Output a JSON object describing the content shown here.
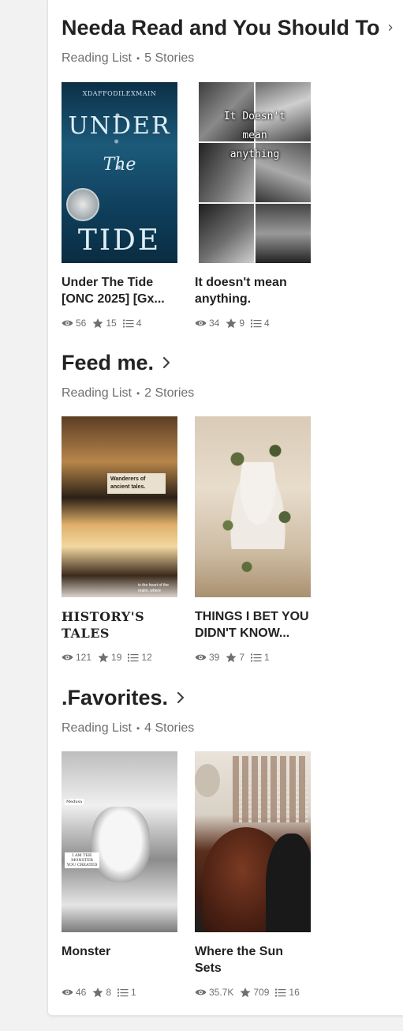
{
  "sections": [
    {
      "title": "Needa Read and You Should To",
      "subtitle_type": "Reading List",
      "subtitle_count": "5 Stories",
      "stories": [
        {
          "title": "Under The Tide [ONC 2025] [Gx...",
          "cover_author": "XDAFFODILEXMAIN",
          "cover_word1": "UNDER",
          "cover_word2": "The",
          "cover_word3": "TIDE",
          "reads": "56",
          "votes": "15",
          "parts": "4"
        },
        {
          "title": "It doesn't mean anything.",
          "cover_line1": "It Doesn't",
          "cover_line2": "mean",
          "cover_line3": "anything",
          "reads": "34",
          "votes": "9",
          "parts": "4"
        }
      ]
    },
    {
      "title": "Feed me.",
      "subtitle_type": "Reading List",
      "subtitle_count": "2 Stories",
      "stories": [
        {
          "title": "HISTORY'S TALES",
          "cover_label": "Wanderers of ancient tales.",
          "cover_bottom": "in the heart of the realm, where",
          "reads": "121",
          "votes": "19",
          "parts": "12"
        },
        {
          "title": "THINGS I BET YOU DIDN'T KNOW...",
          "reads": "39",
          "votes": "7",
          "parts": "1"
        }
      ]
    },
    {
      "title": ".Favorites.",
      "subtitle_type": "Reading List",
      "subtitle_count": "4 Stories",
      "stories": [
        {
          "title": "Monster",
          "cover_tag1": "Medusa",
          "cover_tag2": "I AM THE MONSTER YOU CREATED",
          "reads": "46",
          "votes": "8",
          "parts": "1"
        },
        {
          "title": "Where the Sun Sets",
          "reads": "35.7K",
          "votes": "709",
          "parts": "16"
        }
      ]
    }
  ],
  "icons": {
    "reads": "eye-icon",
    "votes": "star-icon",
    "parts": "list-icon",
    "chevron": "chevron-right-icon"
  },
  "colors": {
    "text": "#222222",
    "muted": "#6f6f6f",
    "background": "#f2f2f2",
    "panel": "#ffffff"
  }
}
